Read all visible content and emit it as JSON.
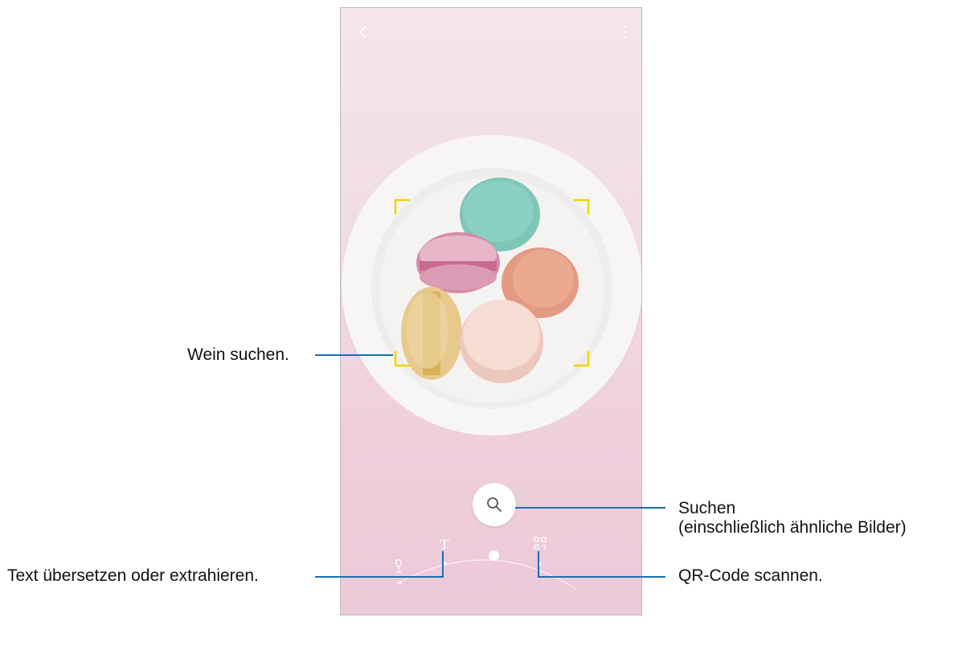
{
  "app": {
    "back_icon": "chevron-left-icon",
    "menu_icon": "more-vertical-icon"
  },
  "scene": {
    "subject": "macarons on plate",
    "focus_frame_color": "#f3d400"
  },
  "modes": {
    "search_icon": "search-icon",
    "text_icon_glyph": "T",
    "qr_icon": "qr-code-icon",
    "wine_icon": "wine-glass-icon"
  },
  "callouts": {
    "wine": "Wein suchen.",
    "text": "Text übersetzen oder extrahieren.",
    "search_line1": "Suchen",
    "search_line2": "(einschließlich ähnliche Bilder)",
    "qr": "QR-Code scannen."
  },
  "colors": {
    "leader_line": "#1a6fb0",
    "background": "#f2dbe3"
  }
}
